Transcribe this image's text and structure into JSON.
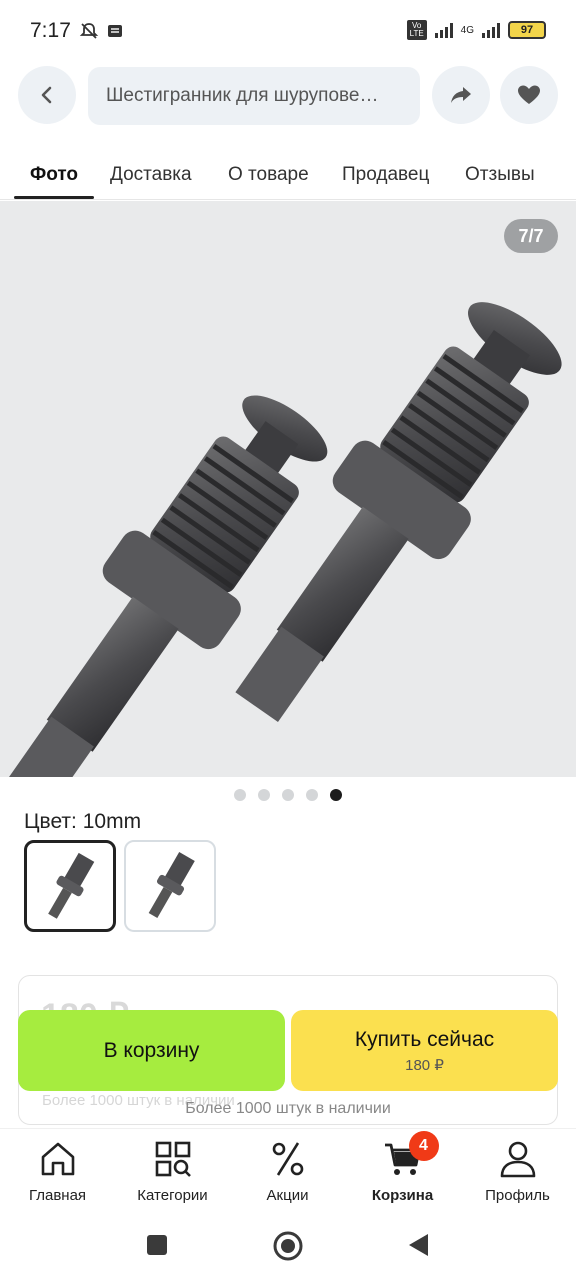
{
  "status": {
    "time": "7:17",
    "network": "4G",
    "volte": "Vo LTE",
    "battery": "97"
  },
  "header": {
    "search_text": "Шестигранник для шурупове…"
  },
  "tabs": [
    {
      "label": "Фото"
    },
    {
      "label": "Доставка"
    },
    {
      "label": "О товаре"
    },
    {
      "label": "Продавец"
    },
    {
      "label": "Отзывы"
    }
  ],
  "gallery": {
    "counter": "7/7",
    "dots_total": 5,
    "active_dot": 5
  },
  "variant": {
    "label": "Цвет: 10mm"
  },
  "actions": {
    "cart_label": "В корзину",
    "buy_label": "Купить сейчас",
    "buy_price": "180 ₽",
    "stock_text": "Более 1000 штук в наличии",
    "price_behind": "180 ₽"
  },
  "bottom_nav": [
    {
      "label": "Главная"
    },
    {
      "label": "Категории"
    },
    {
      "label": "Акции"
    },
    {
      "label": "Корзина",
      "badge": "4"
    },
    {
      "label": "Профиль"
    }
  ],
  "colors": {
    "cart_button": "#a6ec3f",
    "buy_button": "#fbe04f",
    "badge": "#f03a17"
  }
}
